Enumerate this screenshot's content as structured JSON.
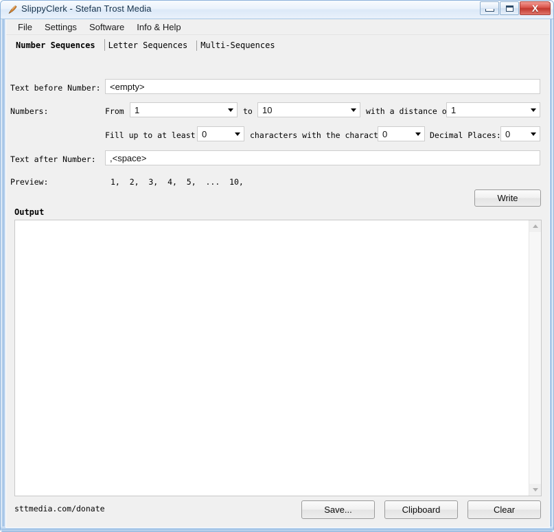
{
  "window": {
    "title": "SlippyClerk - Stefan Trost Media",
    "app_icon": "pen-icon",
    "controls": {
      "minimize": "minimize-icon",
      "maximize": "maximize-icon",
      "close": "X"
    }
  },
  "menubar": {
    "items": [
      {
        "label": "File"
      },
      {
        "label": "Settings"
      },
      {
        "label": "Software"
      },
      {
        "label": "Info & Help"
      }
    ]
  },
  "tabs": [
    {
      "label": "Number Sequences",
      "active": true
    },
    {
      "label": "Letter Sequences",
      "active": false
    },
    {
      "label": "Multi-Sequences",
      "active": false
    }
  ],
  "form": {
    "text_before_label": "Text before Number:",
    "text_before_value": "<empty>",
    "numbers_label": "Numbers:",
    "from_label": "From",
    "from_value": "1",
    "to_label": "to",
    "to_value": "10",
    "distance_label": "with a distance of",
    "distance_value": "1",
    "fill_label": "Fill up to at least",
    "fill_value": "0",
    "chars_label": "characters with the character",
    "chars_value": "0",
    "decimals_label": "Decimal Places:",
    "decimals_value": "0",
    "text_after_label": "Text after Number:",
    "text_after_value": ",<space>",
    "preview_label": "Preview:",
    "preview_value": "1,  2,  3,  4,  5,  ...  10,",
    "write_label": "Write"
  },
  "output": {
    "header": "Output",
    "content": "",
    "scroll_up_icon": "triangle-up-icon",
    "scroll_down_icon": "triangle-down-icon"
  },
  "footer": {
    "donate_link": "sttmedia.com/donate",
    "save_label": "Save...",
    "clipboard_label": "Clipboard",
    "clear_label": "Clear"
  },
  "colors": {
    "frame": "#8cb2da",
    "client_bg": "#f0f0f0",
    "close_button": "#c0382e",
    "field_bg": "#ffffff"
  }
}
